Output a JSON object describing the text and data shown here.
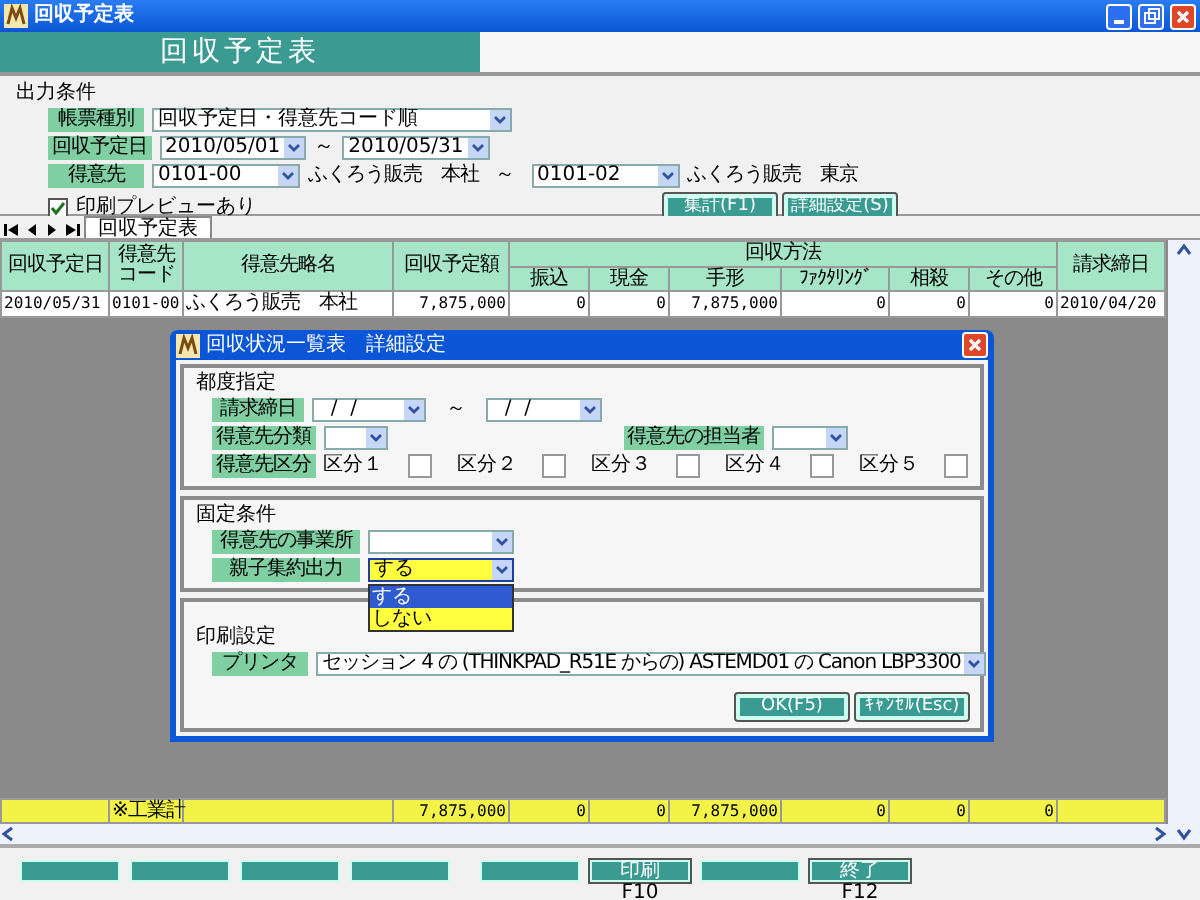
{
  "window": {
    "title": "回収予定表"
  },
  "header": {
    "title": "回収予定表"
  },
  "conditions": {
    "title": "出力条件",
    "report_type": {
      "label": "帳票種別",
      "value": "回収予定日・得意先コード順"
    },
    "due_date": {
      "label": "回収予定日",
      "from": "2010/05/01",
      "separator": "～",
      "to": "2010/05/31"
    },
    "customer": {
      "label": "得意先",
      "from": "0101-00",
      "from_name": "ふくろう販売　本社",
      "separator": "～",
      "to": "0101-02",
      "to_name": "ふくろう販売　東京"
    },
    "preview": {
      "label": "印刷プレビューあり",
      "checked": true
    },
    "buttons": [
      "集計(F1)",
      "詳細設定(S)"
    ]
  },
  "sheet_tabs": [
    {
      "label": "回収予定表",
      "selected": true
    }
  ],
  "table": {
    "columns": [
      {
        "label": "回収予定日"
      },
      {
        "label": "得意先コード"
      },
      {
        "label": "得意先略名"
      },
      {
        "label": "回収予定額"
      },
      {
        "label": "回収方法",
        "colspan": 6,
        "children": [
          "振込",
          "現金",
          "手形",
          "ﾌｧｸﾀﾘﾝｸﾞ",
          "相殺",
          "その他"
        ]
      },
      {
        "label": "請求締日"
      }
    ],
    "rows": [
      [
        "2010/05/31",
        "0101-00",
        "ふくろう販売　本社",
        "7,875,000",
        "0",
        "0",
        "7,875,000",
        "0",
        "0",
        "0",
        "2010/04/20"
      ]
    ],
    "totals": {
      "label": "※工業計",
      "values": [
        "7,875,000",
        "0",
        "0",
        "7,875,000",
        "0",
        "0",
        "0"
      ]
    }
  },
  "dialog": {
    "title": "回収状況一覧表　詳細設定",
    "adhoc": {
      "title": "都度指定",
      "closing_date": {
        "label": "請求締日",
        "from": "  /  /",
        "separator": "～",
        "to": "  /  /"
      },
      "category": {
        "label": "得意先分類"
      },
      "staff": {
        "label": "得意先の担当者"
      },
      "division": {
        "label": "得意先区分",
        "options": [
          {
            "label": "区分１",
            "checked": false
          },
          {
            "label": "区分２",
            "checked": false
          },
          {
            "label": "区分３",
            "checked": false
          },
          {
            "label": "区分４",
            "checked": false
          },
          {
            "label": "区分５",
            "checked": false
          }
        ]
      }
    },
    "fixed": {
      "title": "固定条件",
      "office": {
        "label": "得意先の事業所"
      },
      "aggregate": {
        "label": "親子集約出力",
        "value": "する",
        "expanded": true,
        "options": [
          {
            "label": "する",
            "selected": true
          },
          {
            "label": "しない",
            "selected": false
          }
        ]
      }
    },
    "print": {
      "title": "印刷設定",
      "printer": {
        "label": "プリンタ",
        "value": "セッション 4 の (THINKPAD_R51E からの) ASTEMD01 の Canon LBP3300"
      }
    },
    "buttons": [
      "OK(F5)",
      "ｷｬﾝｾﾙ(Esc)"
    ]
  },
  "function_keys": [
    {
      "kind": "blank"
    },
    {
      "kind": "blank"
    },
    {
      "kind": "blank"
    },
    {
      "kind": "blank"
    },
    {
      "kind": "blank"
    },
    {
      "kind": "labeled",
      "label": "印刷",
      "key": "F10"
    },
    {
      "kind": "blank"
    },
    {
      "kind": "labeled",
      "label": "終了",
      "key": "F12"
    }
  ]
}
